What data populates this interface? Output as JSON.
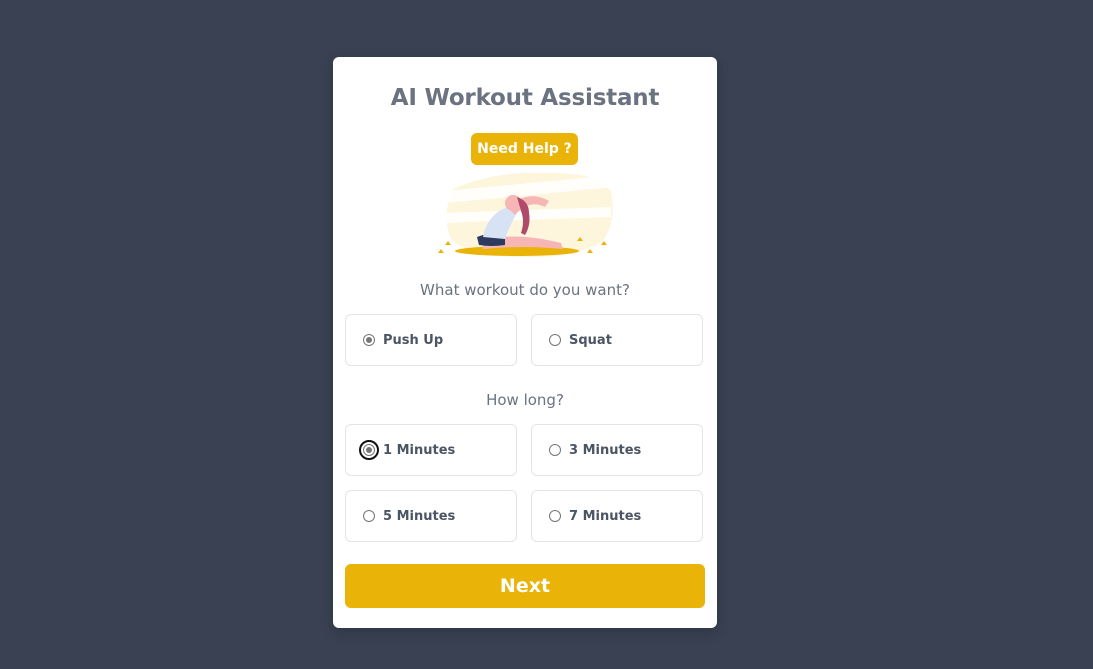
{
  "app": {
    "title": "AI Workout Assistant",
    "help_label": "Need Help ?"
  },
  "workout": {
    "question": "What workout do you want?",
    "options": [
      {
        "label": "Push Up",
        "selected": true
      },
      {
        "label": "Squat",
        "selected": false
      }
    ]
  },
  "duration": {
    "question": "How long?",
    "options": [
      {
        "label": "1 Minutes",
        "selected": true,
        "focused": true
      },
      {
        "label": "3 Minutes",
        "selected": false
      },
      {
        "label": "5 Minutes",
        "selected": false
      },
      {
        "label": "7 Minutes",
        "selected": false
      }
    ]
  },
  "actions": {
    "next_label": "Next"
  },
  "colors": {
    "background": "#394152",
    "accent": "#eab308",
    "card": "#ffffff",
    "text_muted": "#6b7280"
  },
  "icons": {
    "illustration": "yoga-stretch-illustration"
  }
}
